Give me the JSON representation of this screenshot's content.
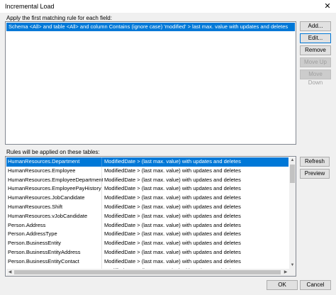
{
  "window": {
    "title": "Incremental Load",
    "close_glyph": "✕"
  },
  "rules_section": {
    "label": "Apply the first matching rule for each field:",
    "items": [
      "Schema <All> and table <All> and column Contains (ignore case) 'modified' > last max. value  with updates and deletes"
    ]
  },
  "rule_buttons": {
    "add": "Add...",
    "edit": "Edit...",
    "remove": "Remove",
    "move_up": "Move Up",
    "move_down": "Move Down"
  },
  "tables_section": {
    "label": "Rules will be applied on these tables:",
    "rows": [
      {
        "table": "HumanResources.Department",
        "rule": "ModifiedDate > (last max. value) with updates and deletes"
      },
      {
        "table": "HumanResources.Employee",
        "rule": "ModifiedDate > (last max. value) with updates and deletes"
      },
      {
        "table": "HumanResources.EmployeeDepartmentHistory",
        "rule": "ModifiedDate > (last max. value) with updates and deletes"
      },
      {
        "table": "HumanResources.EmployeePayHistory",
        "rule": "ModifiedDate > (last max. value) with updates and deletes"
      },
      {
        "table": "HumanResources.JobCandidate",
        "rule": "ModifiedDate > (last max. value) with updates and deletes"
      },
      {
        "table": "HumanResources.Shift",
        "rule": "ModifiedDate > (last max. value) with updates and deletes"
      },
      {
        "table": "HumanResources.vJobCandidate",
        "rule": "ModifiedDate > (last max. value) with updates and deletes"
      },
      {
        "table": "Person.Address",
        "rule": "ModifiedDate > (last max. value) with updates and deletes"
      },
      {
        "table": "Person.AddressType",
        "rule": "ModifiedDate > (last max. value) with updates and deletes"
      },
      {
        "table": "Person.BusinessEntity",
        "rule": "ModifiedDate > (last max. value) with updates and deletes"
      },
      {
        "table": "Person.BusinessEntityAddress",
        "rule": "ModifiedDate > (last max. value) with updates and deletes"
      },
      {
        "table": "Person.BusinessEntityContact",
        "rule": "ModifiedDate > (last max. value) with updates and deletes"
      },
      {
        "table": "Person.ContactType",
        "rule": "ModifiedDate > (last max. value) with updates and deletes"
      }
    ]
  },
  "table_buttons": {
    "refresh": "Refresh",
    "preview": "Preview"
  },
  "dialog_buttons": {
    "ok": "OK",
    "cancel": "Cancel"
  },
  "scroll_glyphs": {
    "up": "▲",
    "down": "▼",
    "left": "◀",
    "right": "▶"
  },
  "colors": {
    "selection": "#0078d7",
    "focus_border": "#0078d7"
  }
}
